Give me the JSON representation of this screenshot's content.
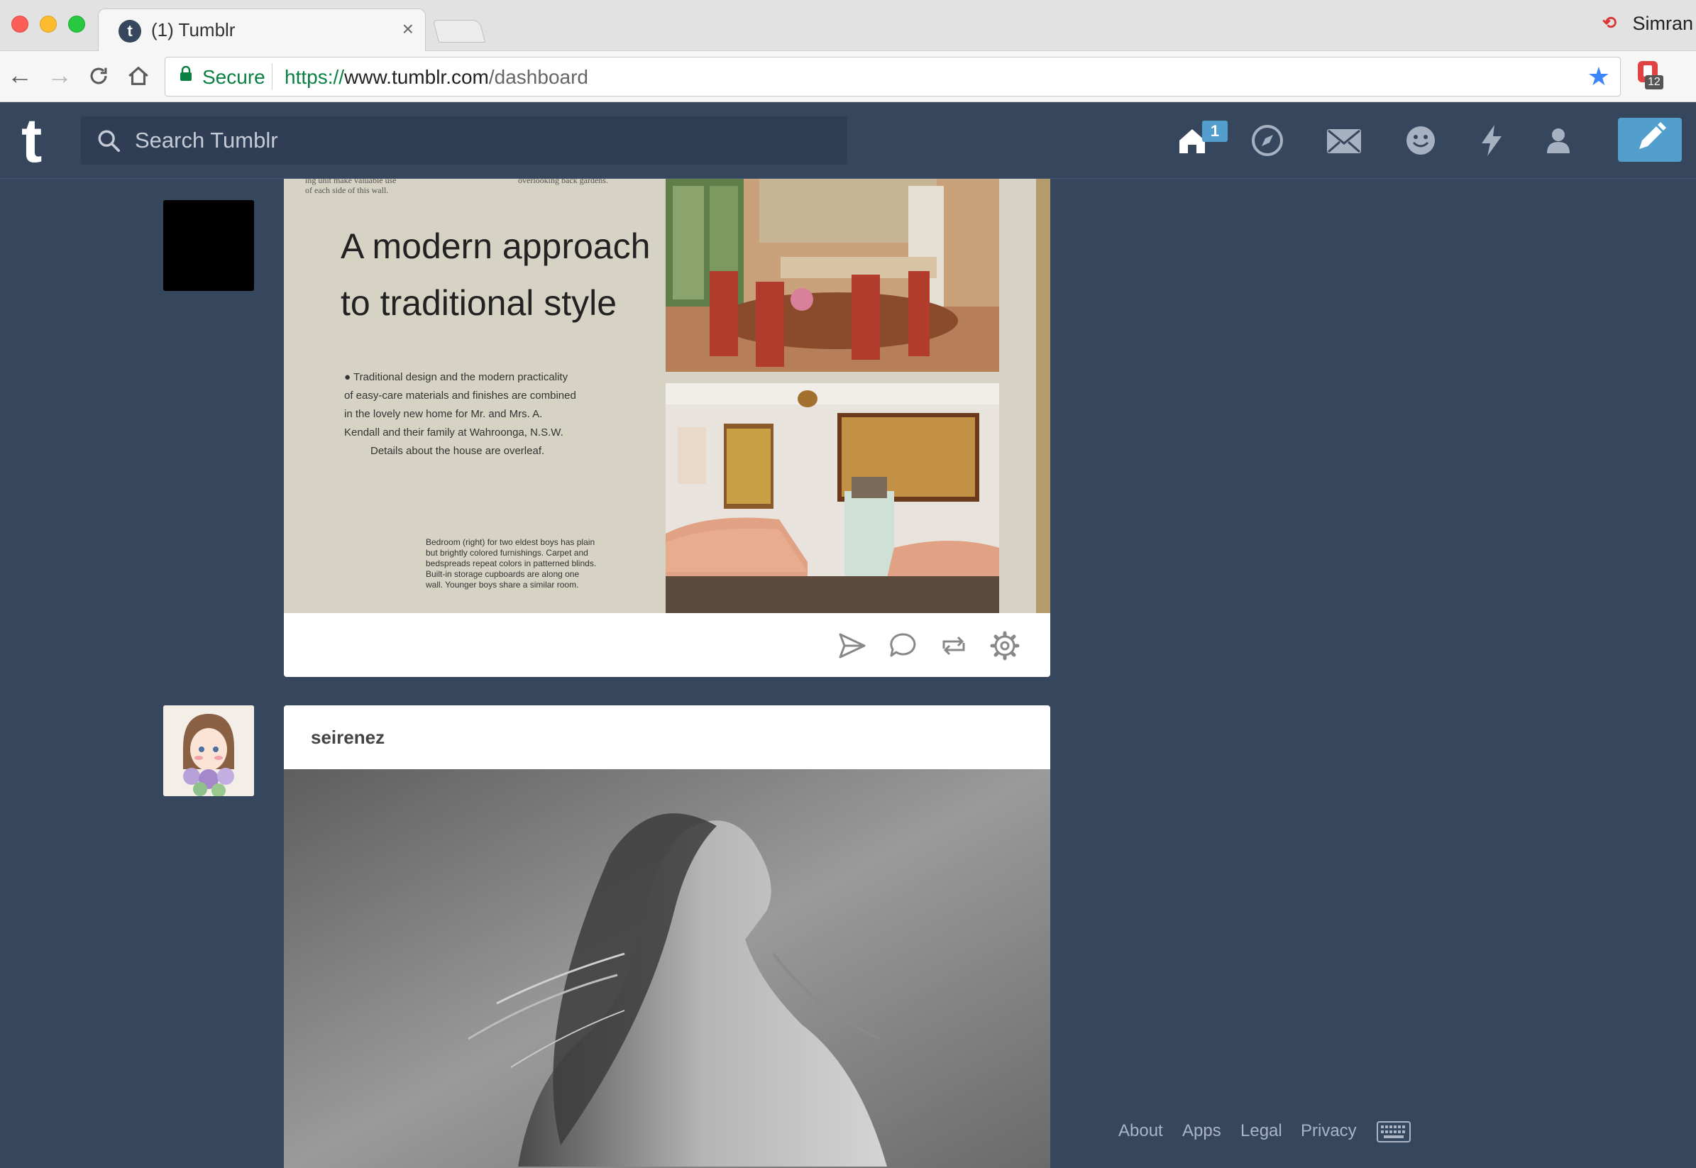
{
  "browser": {
    "tab_title": "(1) Tumblr",
    "tab_favicon_letter": "t",
    "tab_close": "×",
    "profile_name": "Simran",
    "secure_label": "Secure",
    "url_scheme": "https://",
    "url_host": "www.tumblr.com",
    "url_path": "/dashboard",
    "extension_badge": "12"
  },
  "header": {
    "logo": "t",
    "search_placeholder": "Search Tumblr",
    "home_badge": "1"
  },
  "posts": [
    {
      "photo": {
        "fragment_left_top": "ing unit make valuable use",
        "fragment_left_bottom": "of each side of this wall.",
        "fragment_right": "overlooking back gardens.",
        "headline_line1": "A modern approach",
        "headline_line2": "to traditional style",
        "body": [
          "● Traditional design and the modern practicality",
          "of easy-care materials and finishes are combined",
          "in the lovely new home for Mr. and Mrs. A.",
          "Kendall and their family at Wahroonga, N.S.W.",
          "Details about the house are overleaf."
        ],
        "caption": [
          "Bedroom (right) for two eldest boys has plain",
          "but brightly colored furnishings.   Carpet and",
          "bedspreads repeat colors in patterned blinds.",
          "Built-in  storage  cupboards  are  along  one",
          "wall.   Younger  boys  share  a  similar  room."
        ]
      },
      "actions": [
        "share-icon",
        "reply-icon",
        "reblog-icon",
        "settings-icon"
      ]
    },
    {
      "blog_name": "seirenez"
    }
  ],
  "footer": {
    "about": "About",
    "apps": "Apps",
    "legal": "Legal",
    "privacy": "Privacy"
  },
  "colors": {
    "background": "#36465d",
    "accent": "#529ecc",
    "secure_green": "#0b8043",
    "star_blue": "#3d84f5"
  }
}
